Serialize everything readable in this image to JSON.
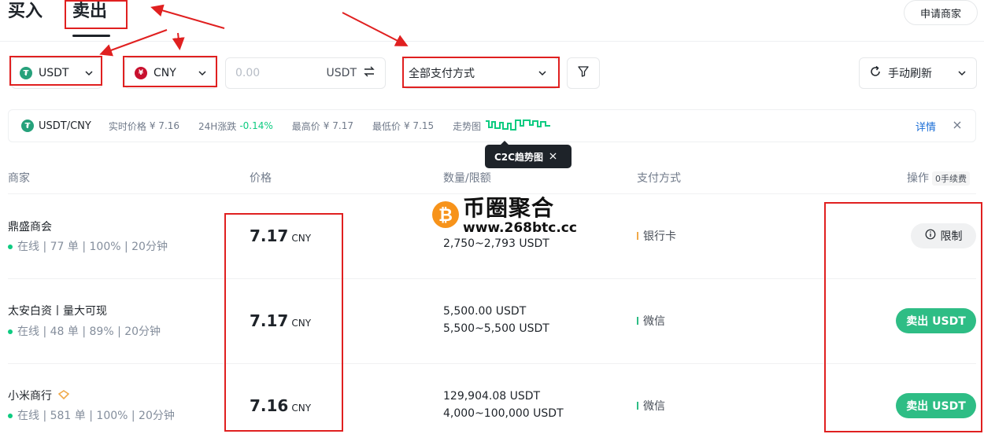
{
  "tabs": {
    "buy": "买入",
    "sell": "卖出"
  },
  "apply_merchant": "申请商家",
  "filters": {
    "coin": "USDT",
    "fiat": "CNY",
    "amount_placeholder": "0.00",
    "amount_unit": "USDT",
    "payment": "全部支付方式",
    "refresh": "手动刷新"
  },
  "ticker": {
    "pair": "USDT/CNY",
    "realtime_label": "实时价格",
    "realtime_value": "¥ 7.16",
    "change_label": "24H涨跌",
    "change_value": "-0.14%",
    "high_label": "最高价",
    "high_value": "¥ 7.17",
    "low_label": "最低价",
    "low_value": "¥ 7.15",
    "trend_label": "走势图",
    "details": "详情"
  },
  "tooltip": "C2C趋势图",
  "table": {
    "headers": {
      "merchant": "商家",
      "price": "价格",
      "qty": "数量/限额",
      "payment": "支付方式",
      "action": "操作",
      "fee": "0手续费"
    },
    "rows": [
      {
        "name": "鼎盛商会",
        "stats": "在线 | 77 单 | 100% | 20分钟",
        "price": "7.17",
        "unit": "CNY",
        "qty": "2,750~2,793 USDT",
        "payment": "银行卡",
        "pay_color": "#f0a94a",
        "action": "限制"
      },
      {
        "name": "太安白资丨量大可现",
        "stats": "在线 | 48 单 | 89% | 20分钟",
        "price": "7.17",
        "unit": "CNY",
        "qty1": "5,500.00 USDT",
        "qty2": "5,500~5,500 USDT",
        "payment": "微信",
        "pay_color": "#2ebd85",
        "action": "卖出 USDT"
      },
      {
        "name": "小米商行",
        "stats": "在线 | 581 单 | 100% | 20分钟",
        "price": "7.16",
        "unit": "CNY",
        "qty1": "129,904.08 USDT",
        "qty2": "4,000~100,000 USDT",
        "payment": "微信",
        "pay_color": "#2ebd85",
        "action": "卖出 USDT"
      }
    ]
  },
  "watermark": {
    "title": "币圈聚合",
    "url": "www.268btc.cc"
  },
  "colors": {
    "accent_green": "#2ebd85",
    "annotation_red": "#e02020",
    "up_green": "#0ecb81"
  }
}
